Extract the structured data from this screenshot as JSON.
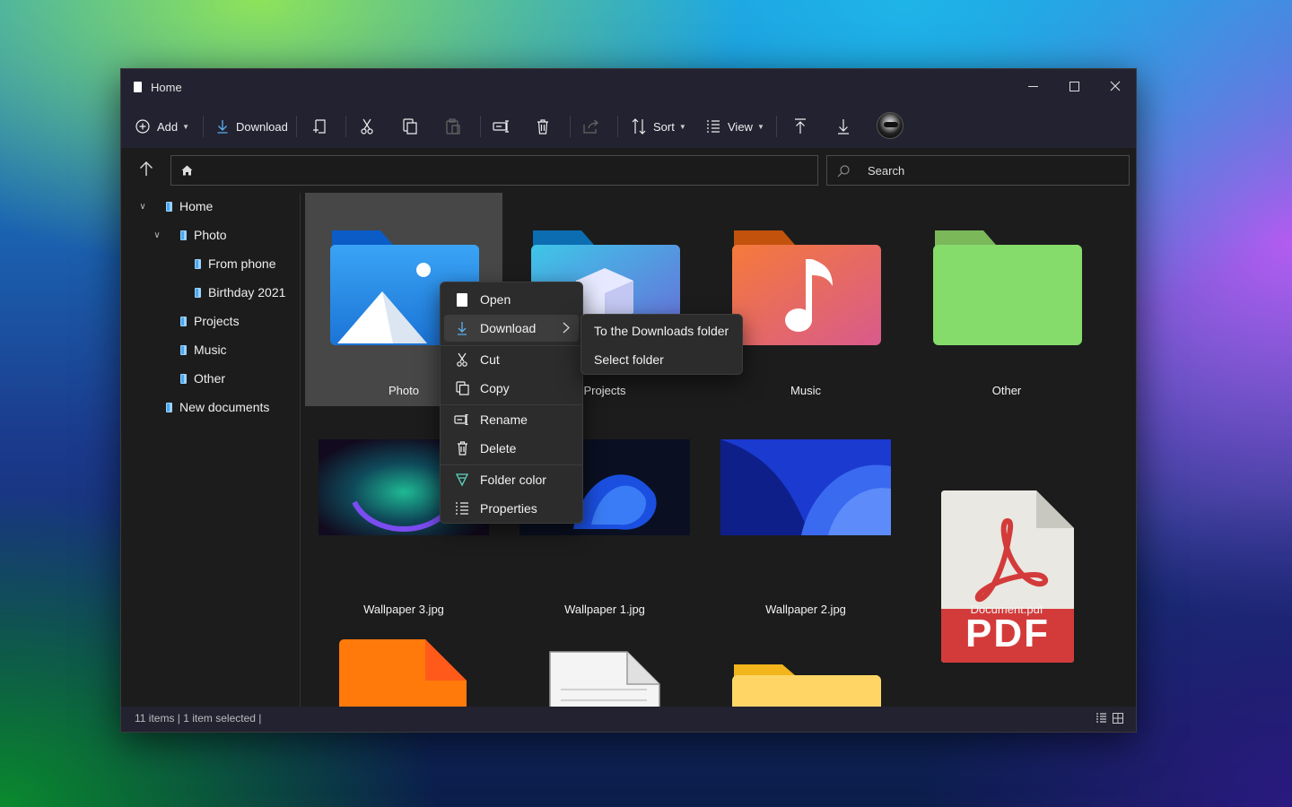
{
  "window": {
    "title": "Home"
  },
  "toolbar": {
    "add_label": "Add",
    "download_label": "Download",
    "sort_label": "Sort",
    "view_label": "View"
  },
  "search": {
    "placeholder": "Search"
  },
  "sidebar": {
    "items": [
      {
        "label": "Home"
      },
      {
        "label": "Photo"
      },
      {
        "label": "From phone"
      },
      {
        "label": "Birthday 2021"
      },
      {
        "label": "Projects"
      },
      {
        "label": "Music"
      },
      {
        "label": "Other"
      },
      {
        "label": "New documents"
      }
    ]
  },
  "files": [
    {
      "label": "Photo"
    },
    {
      "label": "Projects"
    },
    {
      "label": "Music"
    },
    {
      "label": "Other"
    },
    {
      "label": "Wallpaper 3.jpg"
    },
    {
      "label": "Wallpaper 1.jpg"
    },
    {
      "label": "Wallpaper 2.jpg"
    },
    {
      "label": "Document.pdf"
    }
  ],
  "pdf_badge": "PDF",
  "context_menu": {
    "items": [
      {
        "label": "Open"
      },
      {
        "label": "Download"
      },
      {
        "label": "Cut"
      },
      {
        "label": "Copy"
      },
      {
        "label": "Rename"
      },
      {
        "label": "Delete"
      },
      {
        "label": "Folder color"
      },
      {
        "label": "Properties"
      }
    ]
  },
  "submenu": {
    "items": [
      {
        "label": "To the Downloads folder"
      },
      {
        "label": "Select folder"
      }
    ]
  },
  "status": {
    "text": "11 items | 1 item selected |"
  }
}
